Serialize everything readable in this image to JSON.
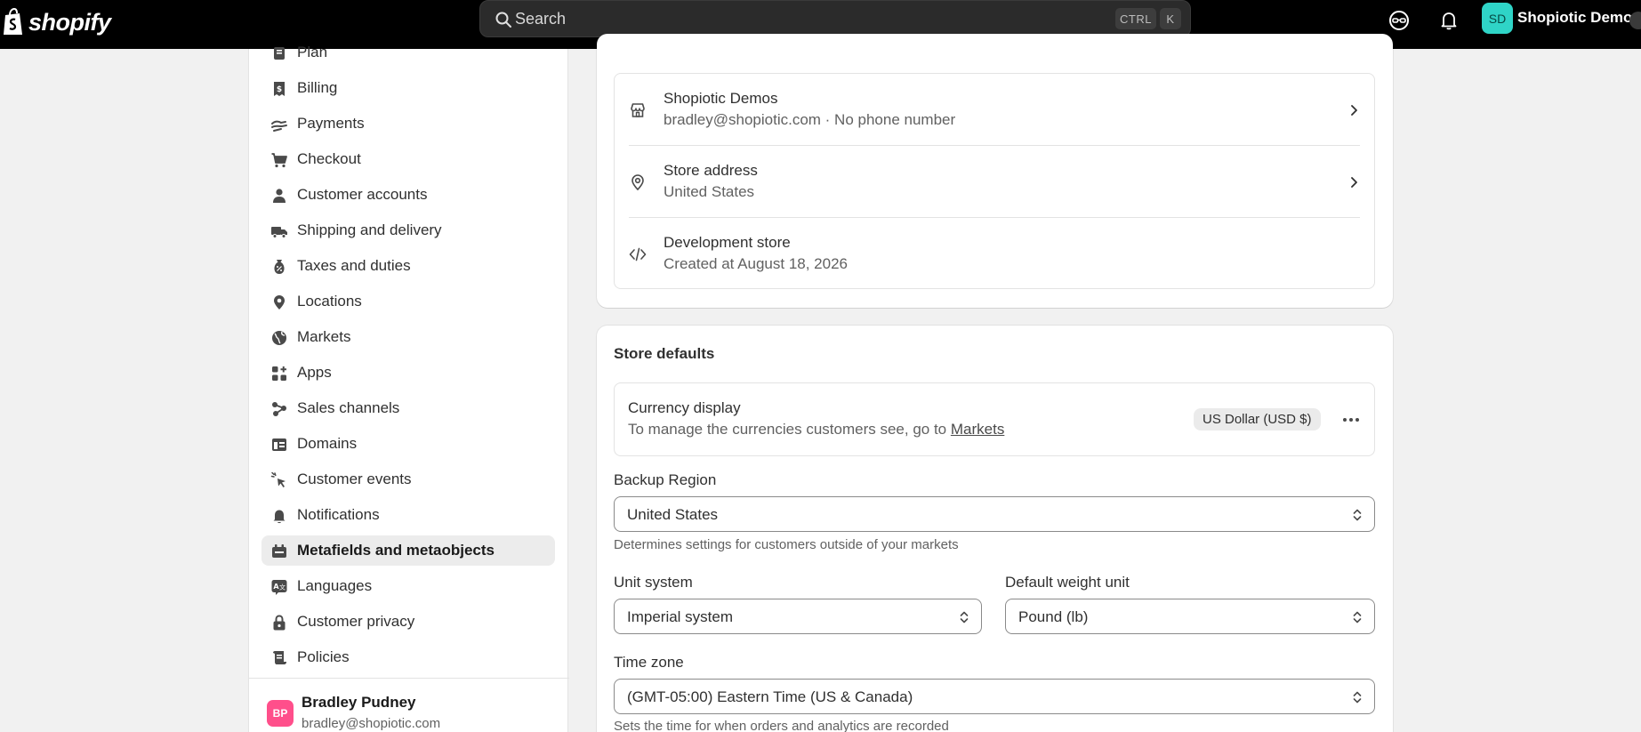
{
  "topbar": {
    "logo_text": "shopify",
    "search_placeholder": "Search",
    "shortcut_ctrl": "CTRL",
    "shortcut_k": "K",
    "store_initials": "SD",
    "store_name": "Shopiotic Demos"
  },
  "sidebar": {
    "items": [
      {
        "label": "Plan",
        "icon": "plan-icon"
      },
      {
        "label": "Billing",
        "icon": "billing-icon"
      },
      {
        "label": "Payments",
        "icon": "payments-icon"
      },
      {
        "label": "Checkout",
        "icon": "cart-icon"
      },
      {
        "label": "Customer accounts",
        "icon": "person-icon"
      },
      {
        "label": "Shipping and delivery",
        "icon": "truck-icon"
      },
      {
        "label": "Taxes and duties",
        "icon": "tax-bag-icon"
      },
      {
        "label": "Locations",
        "icon": "location-pin-icon"
      },
      {
        "label": "Markets",
        "icon": "globe-icon"
      },
      {
        "label": "Apps",
        "icon": "apps-icon"
      },
      {
        "label": "Sales channels",
        "icon": "sales-channels-icon"
      },
      {
        "label": "Domains",
        "icon": "domains-icon"
      },
      {
        "label": "Customer events",
        "icon": "cursor-click-icon"
      },
      {
        "label": "Notifications",
        "icon": "bell-icon"
      },
      {
        "label": "Metafields and metaobjects",
        "icon": "metafields-icon"
      },
      {
        "label": "Languages",
        "icon": "languages-icon"
      },
      {
        "label": "Customer privacy",
        "icon": "lock-icon"
      },
      {
        "label": "Policies",
        "icon": "policies-icon"
      }
    ],
    "active_index": 14,
    "user": {
      "initials": "BP",
      "name": "Bradley Pudney",
      "email": "bradley@shopiotic.com"
    }
  },
  "profile": {
    "rows": [
      {
        "title": "Shopiotic Demos",
        "subtitle": "bradley@shopiotic.com · No phone number",
        "icon": "store-icon"
      },
      {
        "title": "Store address",
        "subtitle": "United States",
        "icon": "location-pin-icon"
      },
      {
        "title": "Development store",
        "subtitle": "Created at August 18, 2026",
        "icon": "code-icon"
      }
    ]
  },
  "defaults": {
    "title": "Store defaults",
    "currency": {
      "title": "Currency display",
      "subtitle_prefix": "To manage the currencies customers see, go to ",
      "link": "Markets",
      "badge": "US Dollar (USD $)"
    },
    "backup_region": {
      "label": "Backup Region",
      "value": "United States",
      "help": "Determines settings for customers outside of your markets"
    },
    "unit_system": {
      "label": "Unit system",
      "value": "Imperial system"
    },
    "weight_unit": {
      "label": "Default weight unit",
      "value": "Pound (lb)"
    },
    "time_zone": {
      "label": "Time zone",
      "value": "(GMT-05:00) Eastern Time (US & Canada)",
      "help": "Sets the time for when orders and analytics are recorded"
    }
  },
  "colors": {
    "topbar_bg": "#000000",
    "page_bg": "#f1f1f1",
    "store_avatar": "#2fd4c7",
    "user_avatar": "#ff4f8b",
    "active_nav_bg": "#ececec"
  }
}
